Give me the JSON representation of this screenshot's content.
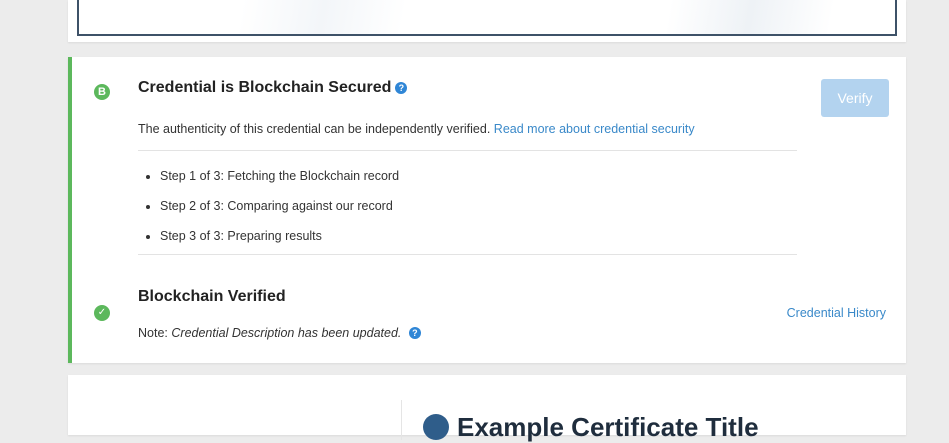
{
  "credential": {
    "blockchain": {
      "badge_letter": "B",
      "title": "Credential is Blockchain Secured",
      "description": "The authenticity of this credential can be independently verified.",
      "read_more_link": "Read more about credential security",
      "verify_label": "Verify",
      "steps": [
        "Step 1 of 3: Fetching the Blockchain record",
        "Step 2 of 3: Comparing against our record",
        "Step 3 of 3: Preparing results"
      ]
    },
    "verified": {
      "title": "Blockchain Verified",
      "note_prefix": "Note:",
      "note_text": "Credential Description has been updated.",
      "history_link": "Credential History"
    }
  },
  "bottom": {
    "title_partial": "Example Certificate Title"
  },
  "colors": {
    "accent_green": "#5cb85c",
    "link_blue": "#3a89c9",
    "verify_button": "#b3d3ef",
    "help_icon": "#2f86d6"
  }
}
